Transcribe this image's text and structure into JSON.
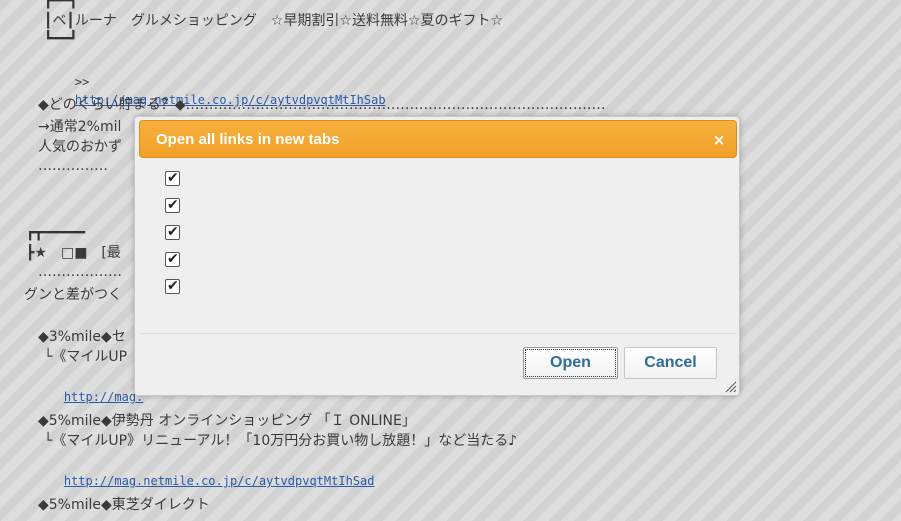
{
  "background": {
    "box_top": "┏━━┓",
    "box_mid": "┃ベ┃ルーナ　グルメショッピング　☆早期割引☆送料無料☆夏のギフト☆",
    "box_bot": "┗━━┛",
    "link_prefix": ">>",
    "link1": "http://mag.netmile.co.jp/c/aytvdpvqtMtIhSab",
    "heading1": "◆どのくらい貯まる？◆………………………………………………………………………………",
    "line_normal": "→通常2%mil",
    "line_popular": "人気のおかず",
    "dots1": "……………",
    "frame_top": "┏┳━━━━━",
    "frame_mid": "┣★　□■　[最",
    "dots2": "………………",
    "line_gun": "グンと差がつく",
    "item3_head": "◆3%mile◆セ",
    "item3_sub": "└《マイルUP",
    "item3_link": "http://mag.",
    "item5_head": "◆5%mile◆伊勢丹 オンラインショッピング 「Ｉ ONLINE」",
    "item5_sub": "└《マイルUP》リニューアル！「10万円分お買い物し放題！」など当たる♪",
    "item5_link": "http://mag.netmile.co.jp/c/aytvdpvqtMtIhSad",
    "item6_head": "◆5%mile◆東芝ダイレクト"
  },
  "dialog": {
    "title": "Open all links in new tabs",
    "close_glyph": "×",
    "checkboxes": [
      {
        "checked": true
      },
      {
        "checked": true
      },
      {
        "checked": true
      },
      {
        "checked": true
      },
      {
        "checked": true
      }
    ],
    "check_glyph": "✔",
    "open_label": "Open",
    "cancel_label": "Cancel"
  },
  "colors": {
    "titlebar": "#f2a02a",
    "title_text": "#ffffff",
    "button_text": "#2d6d9a",
    "link": "#2a5aa8"
  },
  "icons": {
    "close": "close-icon",
    "check": "check-icon",
    "resize": "resize-grip-icon"
  }
}
